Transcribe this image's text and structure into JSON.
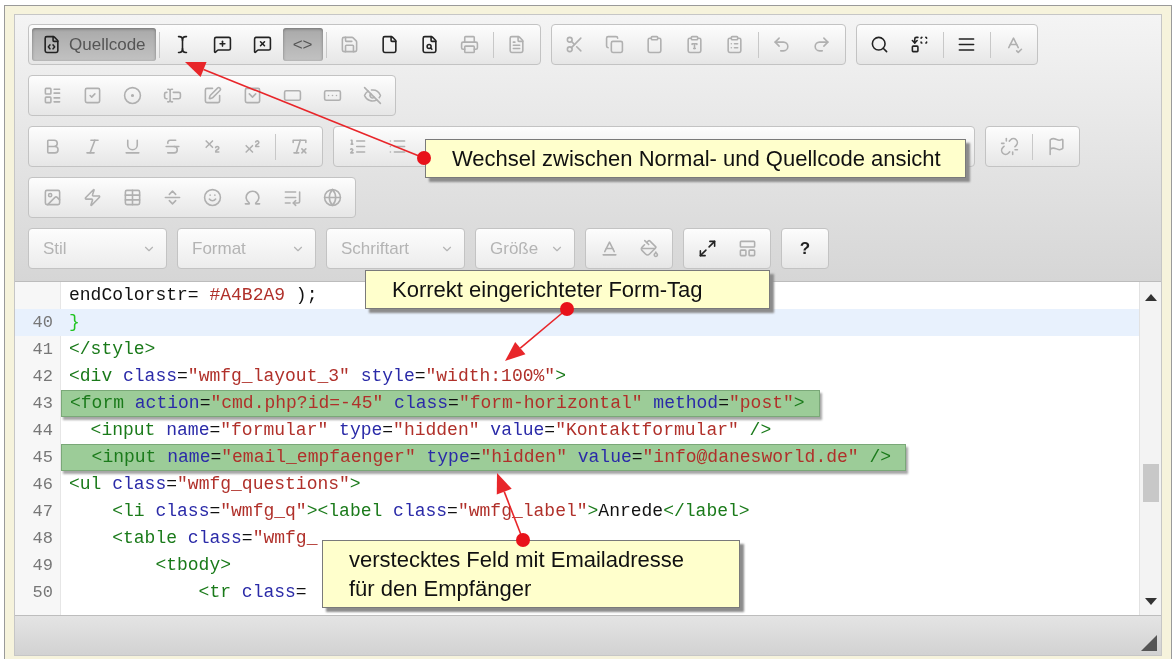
{
  "toolbar": {
    "rows": [
      {
        "groups": [
          {
            "kind": "buttons",
            "sections": [
              [
                {
                  "kind": "source",
                  "label": "Quellcode",
                  "selected": true,
                  "disabled": false
                }
              ],
              [
                {
                  "kind": "selectall",
                  "selected": false,
                  "disabled": false
                },
                {
                  "kind": "commentadd",
                  "selected": false,
                  "disabled": false
                },
                {
                  "kind": "commentremove",
                  "selected": false,
                  "disabled": false
                },
                {
                  "kind": "text",
                  "label": "<>",
                  "selected": true,
                  "disabled": false
                }
              ],
              [
                {
                  "kind": "save",
                  "selected": false,
                  "disabled": true
                },
                {
                  "kind": "newpage",
                  "selected": false,
                  "disabled": false
                },
                {
                  "kind": "preview",
                  "selected": false,
                  "disabled": false
                },
                {
                  "kind": "print",
                  "selected": false,
                  "disabled": true
                }
              ],
              [
                {
                  "kind": "template",
                  "selected": false,
                  "disabled": true
                }
              ]
            ]
          },
          {
            "kind": "buttons",
            "sections": [
              [
                {
                  "kind": "cut",
                  "selected": false,
                  "disabled": true
                },
                {
                  "kind": "copy",
                  "selected": false,
                  "disabled": true
                },
                {
                  "kind": "paste",
                  "selected": false,
                  "disabled": true
                },
                {
                  "kind": "pastetext",
                  "selected": false,
                  "disabled": true
                },
                {
                  "kind": "pasteword",
                  "selected": false,
                  "disabled": true
                }
              ],
              [
                {
                  "kind": "undo",
                  "selected": false,
                  "disabled": true
                },
                {
                  "kind": "redo",
                  "selected": false,
                  "disabled": true
                }
              ]
            ]
          },
          {
            "kind": "buttons",
            "sections": [
              [
                {
                  "kind": "find",
                  "selected": false,
                  "disabled": false
                },
                {
                  "kind": "replace",
                  "selected": false,
                  "disabled": false
                }
              ],
              [
                {
                  "kind": "selectblock",
                  "selected": false,
                  "disabled": false
                }
              ],
              [
                {
                  "kind": "spellcheck",
                  "selected": false,
                  "disabled": true
                }
              ]
            ]
          }
        ]
      },
      {
        "groups": [
          {
            "kind": "buttons",
            "sections": [
              [
                {
                  "kind": "form",
                  "selected": false,
                  "disabled": true
                },
                {
                  "kind": "checkbox",
                  "selected": false,
                  "disabled": true
                },
                {
                  "kind": "radio",
                  "selected": false,
                  "disabled": true
                },
                {
                  "kind": "textfield",
                  "selected": false,
                  "disabled": true
                },
                {
                  "kind": "textarea",
                  "selected": false,
                  "disabled": true
                },
                {
                  "kind": "select",
                  "selected": false,
                  "disabled": true
                },
                {
                  "kind": "button",
                  "selected": false,
                  "disabled": true
                },
                {
                  "kind": "imagebutton",
                  "selected": false,
                  "disabled": true
                },
                {
                  "kind": "hidden",
                  "selected": false,
                  "disabled": true
                }
              ]
            ]
          }
        ]
      },
      {
        "groups": [
          {
            "kind": "buttons",
            "sections": [
              [
                {
                  "kind": "bold",
                  "selected": false,
                  "disabled": true
                },
                {
                  "kind": "italic",
                  "selected": false,
                  "disabled": true
                },
                {
                  "kind": "underline",
                  "selected": false,
                  "disabled": true
                },
                {
                  "kind": "strike",
                  "selected": false,
                  "disabled": true
                },
                {
                  "kind": "sub",
                  "selected": false,
                  "disabled": true
                },
                {
                  "kind": "sup",
                  "selected": false,
                  "disabled": true
                }
              ],
              [
                {
                  "kind": "removeformat",
                  "selected": false,
                  "disabled": true
                }
              ]
            ]
          },
          {
            "kind": "buttons",
            "sections": [
              [
                {
                  "kind": "ol",
                  "selected": false,
                  "disabled": true
                },
                {
                  "kind": "ul",
                  "selected": false,
                  "disabled": true
                }
              ]
            ]
          },
          {
            "kind": "buttons",
            "sections": [
              [
                {
                  "kind": "unlink",
                  "selected": false,
                  "disabled": true
                }
              ],
              [
                {
                  "kind": "anchor",
                  "selected": false,
                  "disabled": true
                }
              ]
            ]
          }
        ]
      },
      {
        "groups": [
          {
            "kind": "buttons",
            "sections": [
              [
                {
                  "kind": "image",
                  "selected": false,
                  "disabled": true
                },
                {
                  "kind": "flash",
                  "selected": false,
                  "disabled": true
                },
                {
                  "kind": "table",
                  "selected": false,
                  "disabled": true
                },
                {
                  "kind": "hr",
                  "selected": false,
                  "disabled": true
                },
                {
                  "kind": "smiley",
                  "selected": false,
                  "disabled": true
                },
                {
                  "kind": "specialchar",
                  "selected": false,
                  "disabled": true
                },
                {
                  "kind": "pagebreak",
                  "selected": false,
                  "disabled": true
                },
                {
                  "kind": "iframe",
                  "selected": false,
                  "disabled": true
                }
              ]
            ]
          }
        ]
      },
      {
        "groups": [
          {
            "kind": "combo",
            "label": "Stil",
            "disabled": true
          },
          {
            "kind": "combo",
            "label": "Format",
            "disabled": true
          },
          {
            "kind": "combo",
            "label": "Schriftart",
            "disabled": true
          },
          {
            "kind": "combo",
            "label": "Größe",
            "disabled": true
          },
          {
            "kind": "buttons",
            "sections": [
              [
                {
                  "kind": "textcolor",
                  "selected": false,
                  "disabled": true
                },
                {
                  "kind": "bgcolor",
                  "selected": false,
                  "disabled": true
                }
              ]
            ]
          },
          {
            "kind": "buttons",
            "sections": [
              [
                {
                  "kind": "maximize",
                  "selected": false,
                  "disabled": false
                },
                {
                  "kind": "showblocks",
                  "selected": false,
                  "disabled": true
                }
              ]
            ]
          },
          {
            "kind": "buttons",
            "sections": [
              [
                {
                  "kind": "text",
                  "label": "?",
                  "selected": false,
                  "disabled": false
                }
              ]
            ]
          }
        ]
      }
    ]
  },
  "code": {
    "lines": [
      {
        "current": false,
        "highlighted": false,
        "tokens": [
          {
            "kind": "plain",
            "text": "endColorstr= "
          },
          {
            "kind": "string",
            "text": "#A4B2A9"
          },
          {
            "kind": "plain",
            "text": " );"
          }
        ]
      },
      {
        "number": "40",
        "current": true,
        "highlighted": false,
        "tokens": [
          {
            "kind": "brace",
            "text": "}"
          }
        ]
      },
      {
        "number": "41",
        "current": false,
        "highlighted": false,
        "tokens": [
          {
            "kind": "tag",
            "text": "</style>"
          }
        ]
      },
      {
        "number": "42",
        "current": false,
        "highlighted": false,
        "tokens": [
          {
            "kind": "tag",
            "text": "<div"
          },
          {
            "kind": "attr",
            "text": " class"
          },
          {
            "kind": "plain",
            "text": "="
          },
          {
            "kind": "string",
            "text": "\"wmfg_layout_3\""
          },
          {
            "kind": "attr",
            "text": " style"
          },
          {
            "kind": "plain",
            "text": "="
          },
          {
            "kind": "string",
            "text": "\"width:100%\""
          },
          {
            "kind": "tag",
            "text": ">"
          }
        ]
      },
      {
        "number": "43",
        "current": false,
        "highlighted": true,
        "tokens": [
          {
            "kind": "tag",
            "text": "<form"
          },
          {
            "kind": "attr",
            "text": " action"
          },
          {
            "kind": "plain",
            "text": "="
          },
          {
            "kind": "string",
            "text": "\"cmd.php?id=-45\""
          },
          {
            "kind": "attr",
            "text": " class"
          },
          {
            "kind": "plain",
            "text": "="
          },
          {
            "kind": "string",
            "text": "\"form-horizontal\""
          },
          {
            "kind": "attr",
            "text": " method"
          },
          {
            "kind": "plain",
            "text": "="
          },
          {
            "kind": "string",
            "text": "\"post\""
          },
          {
            "kind": "tag",
            "text": ">"
          }
        ]
      },
      {
        "number": "44",
        "current": false,
        "highlighted": false,
        "tokens": [
          {
            "kind": "tag",
            "text": "  <input"
          },
          {
            "kind": "attr",
            "text": " name"
          },
          {
            "kind": "plain",
            "text": "="
          },
          {
            "kind": "string",
            "text": "\"formular\""
          },
          {
            "kind": "attr",
            "text": " type"
          },
          {
            "kind": "plain",
            "text": "="
          },
          {
            "kind": "string",
            "text": "\"hidden\""
          },
          {
            "kind": "attr",
            "text": " value"
          },
          {
            "kind": "plain",
            "text": "="
          },
          {
            "kind": "string",
            "text": "\"Kontaktformular\""
          },
          {
            "kind": "tag",
            "text": " />"
          }
        ]
      },
      {
        "number": "45",
        "current": false,
        "highlighted": true,
        "tokens": [
          {
            "kind": "tag",
            "text": "  <input"
          },
          {
            "kind": "attr",
            "text": " name"
          },
          {
            "kind": "plain",
            "text": "="
          },
          {
            "kind": "string",
            "text": "\"email_empfaenger\""
          },
          {
            "kind": "attr",
            "text": " type"
          },
          {
            "kind": "plain",
            "text": "="
          },
          {
            "kind": "string",
            "text": "\"hidden\""
          },
          {
            "kind": "attr",
            "text": " value"
          },
          {
            "kind": "plain",
            "text": "="
          },
          {
            "kind": "string",
            "text": "\"info@danesworld.de\""
          },
          {
            "kind": "tag",
            "text": " />"
          }
        ]
      },
      {
        "number": "46",
        "current": false,
        "highlighted": false,
        "tokens": [
          {
            "kind": "tag",
            "text": "<ul"
          },
          {
            "kind": "attr",
            "text": " class"
          },
          {
            "kind": "plain",
            "text": "="
          },
          {
            "kind": "string",
            "text": "\"wmfg_questions\""
          },
          {
            "kind": "tag",
            "text": ">"
          }
        ]
      },
      {
        "number": "47",
        "current": false,
        "highlighted": false,
        "tokens": [
          {
            "kind": "tag",
            "text": "    <li"
          },
          {
            "kind": "attr",
            "text": " class"
          },
          {
            "kind": "plain",
            "text": "="
          },
          {
            "kind": "string",
            "text": "\"wmfg_q\""
          },
          {
            "kind": "tag",
            "text": "><label"
          },
          {
            "kind": "attr",
            "text": " class"
          },
          {
            "kind": "plain",
            "text": "="
          },
          {
            "kind": "string",
            "text": "\"wmfg_label\""
          },
          {
            "kind": "tag",
            "text": ">"
          },
          {
            "kind": "plain",
            "text": "Anrede"
          },
          {
            "kind": "tag",
            "text": "</label>"
          }
        ]
      },
      {
        "number": "48",
        "current": false,
        "highlighted": false,
        "tokens": [
          {
            "kind": "tag",
            "text": "    <table"
          },
          {
            "kind": "attr",
            "text": " class"
          },
          {
            "kind": "plain",
            "text": "="
          },
          {
            "kind": "string",
            "text": "\"wmfg_"
          }
        ]
      },
      {
        "number": "49",
        "current": false,
        "highlighted": false,
        "tokens": [
          {
            "kind": "tag",
            "text": "        <tbody>"
          }
        ]
      },
      {
        "number": "50",
        "current": false,
        "highlighted": false,
        "tokens": [
          {
            "kind": "tag",
            "text": "            <tr"
          },
          {
            "kind": "attr",
            "text": " class"
          },
          {
            "kind": "plain",
            "text": "="
          }
        ]
      }
    ]
  },
  "callouts": [
    {
      "text": "Wechsel zwischen Normal- und Quellcode ansicht"
    },
    {
      "text": "Korrekt eingerichteter Form-Tag"
    },
    {
      "text": "verstecktes Feld mit Emailadresse\nfür den Empfänger"
    }
  ]
}
